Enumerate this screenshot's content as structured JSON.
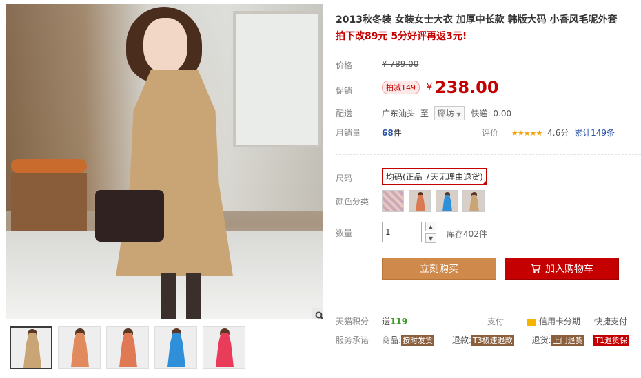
{
  "product": {
    "title": "2013秋冬装 女装女士大衣 加厚中长款 韩版大码 小香风毛呢外套",
    "promo": "拍下改89元 5分好评再返3元!"
  },
  "price_block": {
    "original_label": "价格",
    "original_price": "¥ 789.00",
    "promo_label": "促销",
    "promo_tag": "拍减149",
    "currency": "¥",
    "current_price": "238.00",
    "shipping_label": "配送",
    "ship_from": "广东汕头",
    "ship_to_prefix": "至",
    "ship_to": "廊坊",
    "shipping_fee": "快递: 0.00",
    "monthly_sales_label": "月销量",
    "monthly_sales_value": "68",
    "monthly_sales_unit": "件",
    "rating_label": "评价",
    "rating_stars": "★★★★★",
    "rating_score": "4.6分",
    "reviews": "累计149条"
  },
  "options": {
    "size_label": "尺码",
    "size_selected": "均码(正品 7天无理由退货)",
    "color_label": "颜色分类",
    "colors": [
      "#d9b8b0",
      "#d97a52",
      "#2f8fd8",
      "#c9a474"
    ],
    "quantity_label": "数量",
    "quantity_value": "1",
    "stock": "库存402件"
  },
  "buttons": {
    "buy_now": "立刻购买",
    "add_to_cart": "加入购物车"
  },
  "services": {
    "points_label": "天猫积分",
    "points_prefix": "送",
    "points_value": "119",
    "pay_label": "支付",
    "credit_card": "信用卡分期",
    "quick_pay": "快捷支付",
    "promise_label": "服务承诺",
    "goods_label": "商品:",
    "goods_badge": "按时发货",
    "refund_label": "退款:",
    "refund_badge": "T3极速退款",
    "return_label": "退货:",
    "return_badge": "上门退货",
    "extra_badge": "T1退货保"
  },
  "gallery": {
    "thumb_colors": [
      "#c9a474",
      "#e08a5e",
      "#e07a55",
      "#2f8fd8",
      "#e83c5a"
    ]
  }
}
